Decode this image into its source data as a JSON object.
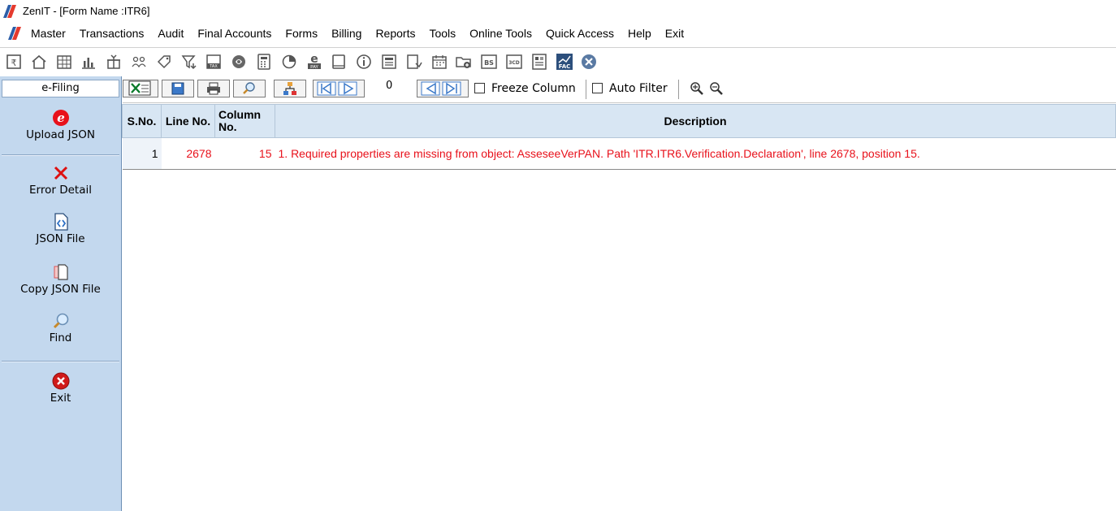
{
  "window": {
    "title": "ZenIT - [Form Name :ITR6]"
  },
  "menu": [
    "Master",
    "Transactions",
    "Audit",
    "Final Accounts",
    "Forms",
    "Billing",
    "Reports",
    "Tools",
    "Online Tools",
    "Quick Access",
    "Help",
    "Exit"
  ],
  "toolbar_icons": [
    "rupee-book-icon",
    "home-icon",
    "spreadsheet-icon",
    "bar-chart-icon",
    "gift-icon",
    "people-icon",
    "tag-icon",
    "filter-icon",
    "tax-icon",
    "eye-icon",
    "calculator-icon",
    "pie-icon",
    "e-pay-icon",
    "book-icon",
    "info-icon",
    "ledger-icon",
    "chart-doc-icon",
    "calendar-icon",
    "folder-add-icon",
    "bs-icon",
    "3cd-icon",
    "report-icon",
    "fac-icon",
    "close-circle-icon"
  ],
  "sidebar": {
    "header": "e-Filing",
    "items": [
      {
        "label": "Upload JSON",
        "icon": "e-upload-icon"
      },
      {
        "label": "Error Detail",
        "icon": "red-x-icon"
      },
      {
        "label": "JSON File",
        "icon": "json-file-icon"
      },
      {
        "label": "Copy JSON File",
        "icon": "copy-file-icon"
      },
      {
        "label": "Find",
        "icon": "magnifier-icon"
      },
      {
        "label": "Exit",
        "icon": "red-close-icon"
      }
    ]
  },
  "gridbar": {
    "record_number": "0",
    "freeze_label": "Freeze Column",
    "autofilter_label": "Auto Filter"
  },
  "grid": {
    "columns": [
      "S.No.",
      "Line No.",
      "Column No.",
      "Description"
    ],
    "rows": [
      {
        "sno": "1",
        "line": "2678",
        "col": "15",
        "desc": "1. Required properties are missing from object: AsseseeVerPAN. Path 'ITR.ITR6.Verification.Declaration', line 2678, position 15."
      }
    ]
  },
  "colors": {
    "sidebar_bg": "#c3d8ee",
    "header_bg": "#d8e6f3",
    "error_text": "#e8111b"
  }
}
